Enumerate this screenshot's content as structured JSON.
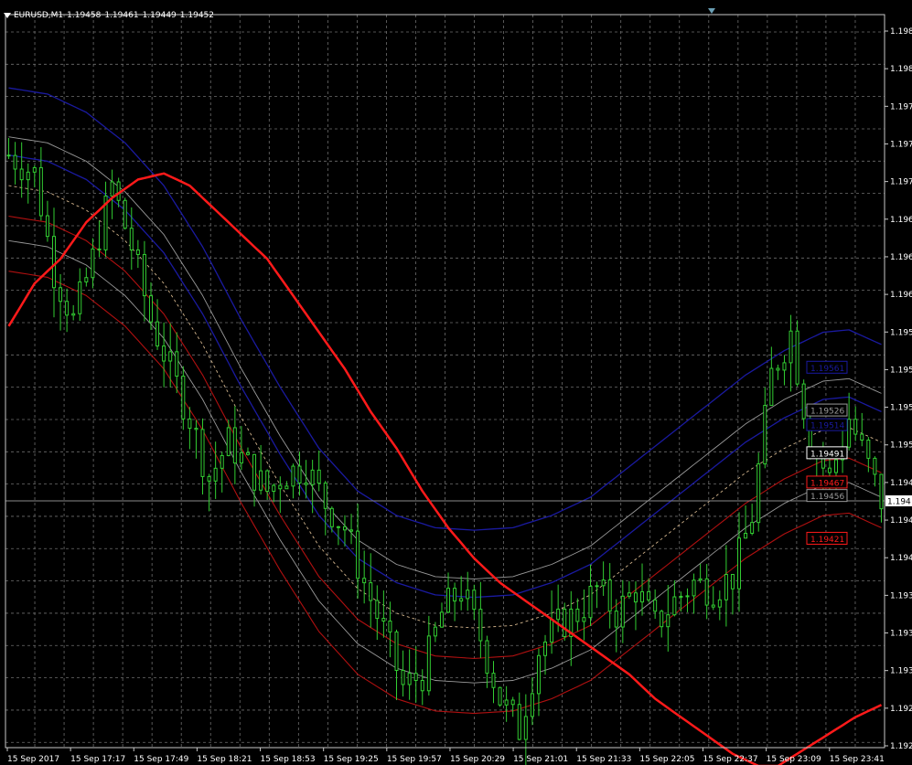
{
  "header": {
    "symbol": "EURUSD,M1",
    "ohlc": [
      "1.19458",
      "1.19461",
      "1.19449",
      "1.19452"
    ]
  },
  "colors": {
    "background": "#000000",
    "grid": "#6e6e6e",
    "candles": "#32cd32",
    "ma_red": "#ff1a1a",
    "band_blue": "#1a1aa0",
    "band_white": "#9a9a9a",
    "band_red": "#b01010",
    "mid_dashed": "#d2b48c",
    "current_price_line": "#8a8a8a"
  },
  "chart_data": {
    "type": "candlestick",
    "symbol": "EURUSD",
    "timeframe": "M1",
    "grid": true,
    "x_labels": [
      "15 Sep 2017",
      "15 Sep 17:17",
      "15 Sep 17:49",
      "15 Sep 18:21",
      "15 Sep 18:53",
      "15 Sep 19:25",
      "15 Sep 19:57",
      "15 Sep 20:29",
      "15 Sep 21:01",
      "15 Sep 21:33",
      "15 Sep 22:05",
      "15 Sep 22:37",
      "15 Sep 23:09",
      "15 Sep 23:41"
    ],
    "y_tick_labels": [
      "1.198",
      "1.198",
      "1.197",
      "1.197",
      "1.197",
      "1.196",
      "1.196",
      "1.196",
      "1.195",
      "1.195",
      "1.195",
      "1.195",
      "1.194",
      "1.194",
      "1.194",
      "1.193",
      "1.193",
      "1.193",
      "1.192",
      "1.192"
    ],
    "close_profile": [
      [
        0,
        1.19735
      ],
      [
        4,
        1.1972
      ],
      [
        7,
        1.1964
      ],
      [
        10,
        1.196
      ],
      [
        13,
        1.1965
      ],
      [
        16,
        1.1971
      ],
      [
        19,
        1.1966
      ],
      [
        22,
        1.196
      ],
      [
        25,
        1.1956
      ],
      [
        28,
        1.1952
      ],
      [
        31,
        1.1947
      ],
      [
        34,
        1.195
      ],
      [
        37,
        1.1948
      ],
      [
        40,
        1.1946
      ],
      [
        43,
        1.19475
      ],
      [
        46,
        1.1948
      ],
      [
        49,
        1.1945
      ],
      [
        52,
        1.1943
      ],
      [
        55,
        1.19385
      ],
      [
        58,
        1.19345
      ],
      [
        61,
        1.193
      ],
      [
        64,
        1.1931
      ],
      [
        67,
        1.1936
      ],
      [
        70,
        1.1938
      ],
      [
        73,
        1.1934
      ],
      [
        76,
        1.1929
      ],
      [
        79,
        1.19265
      ],
      [
        82,
        1.1933
      ],
      [
        85,
        1.1935
      ],
      [
        88,
        1.1936
      ],
      [
        91,
        1.1938
      ],
      [
        94,
        1.1936
      ],
      [
        97,
        1.1938
      ],
      [
        100,
        1.1935
      ],
      [
        103,
        1.1937
      ],
      [
        106,
        1.19385
      ],
      [
        109,
        1.1938
      ],
      [
        112,
        1.1939
      ],
      [
        115,
        1.1944
      ],
      [
        118,
        1.19555
      ],
      [
        121,
        1.1959
      ],
      [
        124,
        1.195
      ],
      [
        127,
        1.1947
      ],
      [
        130,
        1.1952
      ],
      [
        133,
        1.1948
      ],
      [
        135,
        1.19452
      ]
    ],
    "series": [
      {
        "name": "",
        "style": "solid",
        "color": "#ff1a1a",
        "width": 2.5,
        "values": [
          [
            0,
            1.19595
          ],
          [
            4,
            1.1963
          ],
          [
            8,
            1.1965
          ],
          [
            12,
            1.1968
          ],
          [
            16,
            1.197
          ],
          [
            20,
            1.19715
          ],
          [
            24,
            1.1972
          ],
          [
            28,
            1.1971
          ],
          [
            32,
            1.1969
          ],
          [
            36,
            1.1967
          ],
          [
            40,
            1.1965
          ],
          [
            44,
            1.1962
          ],
          [
            48,
            1.1959
          ],
          [
            52,
            1.1956
          ],
          [
            56,
            1.19525
          ],
          [
            60,
            1.19495
          ],
          [
            64,
            1.1946
          ],
          [
            68,
            1.1943
          ],
          [
            72,
            1.19405
          ],
          [
            76,
            1.19385
          ],
          [
            80,
            1.1937
          ],
          [
            84,
            1.19355
          ],
          [
            88,
            1.1934
          ],
          [
            92,
            1.19325
          ],
          [
            96,
            1.1931
          ],
          [
            100,
            1.1929
          ],
          [
            104,
            1.19275
          ],
          [
            108,
            1.1926
          ],
          [
            112,
            1.19245
          ],
          [
            116,
            1.19235
          ],
          [
            119,
            1.19235
          ],
          [
            122,
            1.19245
          ],
          [
            125,
            1.19255
          ],
          [
            128,
            1.19265
          ],
          [
            131,
            1.19275
          ],
          [
            135,
            1.19285
          ]
        ]
      },
      {
        "name": "",
        "style": "solid",
        "color": "#1a1aa0",
        "width": 1.3,
        "values": [
          [
            0,
            1.1979
          ],
          [
            6,
            1.19785
          ],
          [
            12,
            1.1977
          ],
          [
            18,
            1.19745
          ],
          [
            24,
            1.1971
          ],
          [
            30,
            1.1966
          ],
          [
            36,
            1.196
          ],
          [
            42,
            1.19545
          ],
          [
            48,
            1.19495
          ],
          [
            54,
            1.1946
          ],
          [
            60,
            1.1944
          ],
          [
            66,
            1.1943
          ],
          [
            72,
            1.19428
          ],
          [
            78,
            1.1943
          ],
          [
            84,
            1.1944
          ],
          [
            90,
            1.19455
          ],
          [
            96,
            1.1948
          ],
          [
            102,
            1.19505
          ],
          [
            108,
            1.1953
          ],
          [
            114,
            1.19555
          ],
          [
            120,
            1.19575
          ],
          [
            126,
            1.1959
          ],
          [
            130,
            1.19592
          ],
          [
            135,
            1.1958
          ]
        ]
      },
      {
        "name": "",
        "style": "solid",
        "color": "#1a1aa0",
        "width": 1.3,
        "values": [
          [
            0,
            1.19735
          ],
          [
            6,
            1.1973
          ],
          [
            12,
            1.19715
          ],
          [
            18,
            1.1969
          ],
          [
            24,
            1.19655
          ],
          [
            30,
            1.19605
          ],
          [
            36,
            1.19545
          ],
          [
            42,
            1.1949
          ],
          [
            48,
            1.1944
          ],
          [
            54,
            1.19405
          ],
          [
            60,
            1.19385
          ],
          [
            66,
            1.19375
          ],
          [
            72,
            1.19373
          ],
          [
            78,
            1.19375
          ],
          [
            84,
            1.19385
          ],
          [
            90,
            1.194
          ],
          [
            96,
            1.19425
          ],
          [
            102,
            1.1945
          ],
          [
            108,
            1.19475
          ],
          [
            114,
            1.195
          ],
          [
            120,
            1.1952
          ],
          [
            126,
            1.19535
          ],
          [
            130,
            1.19537
          ],
          [
            135,
            1.19525
          ]
        ]
      },
      {
        "name": "",
        "style": "solid",
        "color": "#9a9a9a",
        "width": 0.9,
        "values": [
          [
            0,
            1.1975
          ],
          [
            6,
            1.19745
          ],
          [
            12,
            1.1973
          ],
          [
            18,
            1.19705
          ],
          [
            24,
            1.1967
          ],
          [
            30,
            1.1962
          ],
          [
            36,
            1.1956
          ],
          [
            42,
            1.19505
          ],
          [
            48,
            1.19455
          ],
          [
            54,
            1.1942
          ],
          [
            60,
            1.194
          ],
          [
            66,
            1.1939
          ],
          [
            72,
            1.19388
          ],
          [
            78,
            1.1939
          ],
          [
            84,
            1.194
          ],
          [
            90,
            1.19415
          ],
          [
            96,
            1.1944
          ],
          [
            102,
            1.19465
          ],
          [
            108,
            1.1949
          ],
          [
            114,
            1.19515
          ],
          [
            120,
            1.19535
          ],
          [
            126,
            1.1955
          ],
          [
            130,
            1.19552
          ],
          [
            135,
            1.1954
          ]
        ]
      },
      {
        "name": "",
        "style": "solid",
        "color": "#9a9a9a",
        "width": 0.9,
        "values": [
          [
            0,
            1.19665
          ],
          [
            6,
            1.1966
          ],
          [
            12,
            1.19645
          ],
          [
            18,
            1.1962
          ],
          [
            24,
            1.19585
          ],
          [
            30,
            1.19535
          ],
          [
            36,
            1.19475
          ],
          [
            42,
            1.1942
          ],
          [
            48,
            1.1937
          ],
          [
            54,
            1.19335
          ],
          [
            60,
            1.19315
          ],
          [
            66,
            1.19305
          ],
          [
            72,
            1.19303
          ],
          [
            78,
            1.19305
          ],
          [
            84,
            1.19315
          ],
          [
            90,
            1.1933
          ],
          [
            96,
            1.19355
          ],
          [
            102,
            1.1938
          ],
          [
            108,
            1.19405
          ],
          [
            114,
            1.1943
          ],
          [
            120,
            1.1945
          ],
          [
            126,
            1.19465
          ],
          [
            130,
            1.19467
          ],
          [
            135,
            1.19455
          ]
        ]
      },
      {
        "name": "",
        "style": "dashed",
        "color": "#d2b48c",
        "width": 0.9,
        "values": [
          [
            0,
            1.1971
          ],
          [
            6,
            1.19705
          ],
          [
            12,
            1.1969
          ],
          [
            18,
            1.19665
          ],
          [
            24,
            1.1963
          ],
          [
            30,
            1.1958
          ],
          [
            36,
            1.1952
          ],
          [
            42,
            1.19465
          ],
          [
            48,
            1.19415
          ],
          [
            54,
            1.1938
          ],
          [
            60,
            1.1936
          ],
          [
            66,
            1.1935
          ],
          [
            72,
            1.19348
          ],
          [
            78,
            1.1935
          ],
          [
            84,
            1.1936
          ],
          [
            90,
            1.19375
          ],
          [
            96,
            1.194
          ],
          [
            102,
            1.19425
          ],
          [
            108,
            1.1945
          ],
          [
            114,
            1.19475
          ],
          [
            120,
            1.19495
          ],
          [
            126,
            1.1951
          ],
          [
            130,
            1.19512
          ],
          [
            135,
            1.195
          ]
        ]
      },
      {
        "name": "",
        "style": "solid",
        "color": "#b01010",
        "width": 1.1,
        "values": [
          [
            0,
            1.19685
          ],
          [
            6,
            1.1968
          ],
          [
            12,
            1.19665
          ],
          [
            18,
            1.1964
          ],
          [
            24,
            1.19605
          ],
          [
            30,
            1.19555
          ],
          [
            36,
            1.19495
          ],
          [
            42,
            1.1944
          ],
          [
            48,
            1.1939
          ],
          [
            54,
            1.19355
          ],
          [
            60,
            1.19335
          ],
          [
            66,
            1.19325
          ],
          [
            72,
            1.19323
          ],
          [
            78,
            1.19325
          ],
          [
            84,
            1.19335
          ],
          [
            90,
            1.1935
          ],
          [
            96,
            1.19375
          ],
          [
            102,
            1.194
          ],
          [
            108,
            1.19425
          ],
          [
            114,
            1.1945
          ],
          [
            120,
            1.1947
          ],
          [
            126,
            1.19485
          ],
          [
            130,
            1.19487
          ],
          [
            135,
            1.19475
          ]
        ]
      },
      {
        "name": "",
        "style": "solid",
        "color": "#b01010",
        "width": 1.1,
        "values": [
          [
            0,
            1.1964
          ],
          [
            6,
            1.19635
          ],
          [
            12,
            1.1962
          ],
          [
            18,
            1.19595
          ],
          [
            24,
            1.1956
          ],
          [
            30,
            1.1951
          ],
          [
            36,
            1.1945
          ],
          [
            42,
            1.19395
          ],
          [
            48,
            1.19345
          ],
          [
            54,
            1.1931
          ],
          [
            60,
            1.1929
          ],
          [
            66,
            1.1928
          ],
          [
            72,
            1.19278
          ],
          [
            78,
            1.1928
          ],
          [
            84,
            1.1929
          ],
          [
            90,
            1.19305
          ],
          [
            96,
            1.1933
          ],
          [
            102,
            1.19355
          ],
          [
            108,
            1.1938
          ],
          [
            114,
            1.19405
          ],
          [
            120,
            1.19425
          ],
          [
            126,
            1.1944
          ],
          [
            130,
            1.19442
          ],
          [
            135,
            1.1943
          ]
        ]
      }
    ],
    "price_labels": [
      {
        "text": "1.19561",
        "color": "#1a1aa0",
        "bg": "#000000",
        "value": 1.19561
      },
      {
        "text": "1.19526",
        "color": "#9a9a9a",
        "bg": "#000000",
        "value": 1.19526
      },
      {
        "text": "1.19514",
        "color": "#1a1aa0",
        "bg": "#000000",
        "value": 1.19514
      },
      {
        "text": "1.19491",
        "color": "#ffffff",
        "bg": "#000000",
        "value": 1.19491
      },
      {
        "text": "1.19467",
        "color": "#ff1a1a",
        "bg": "#000000",
        "value": 1.19467
      },
      {
        "text": "1.19456",
        "color": "#9a9a9a",
        "bg": "#000000",
        "value": 1.19456
      },
      {
        "text": "1.19421",
        "color": "#ff1a1a",
        "bg": "#000000",
        "value": 1.19421
      }
    ],
    "current_price_label": "1.194"
  }
}
